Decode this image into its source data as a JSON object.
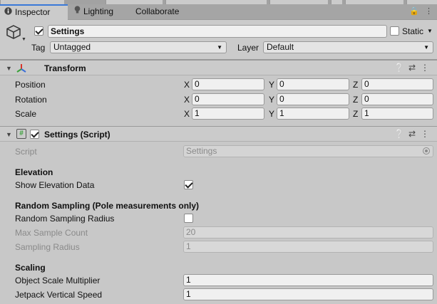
{
  "tabs": [
    {
      "label": "Inspector",
      "icon": "info-icon",
      "active": true
    },
    {
      "label": "Lighting",
      "icon": "bulb-icon",
      "active": false
    },
    {
      "label": "Collaborate",
      "active": false
    }
  ],
  "header": {
    "active_checked": true,
    "name": "Settings",
    "static_label": "Static",
    "static_checked": false,
    "tag_label": "Tag",
    "tag_value": "Untagged",
    "layer_label": "Layer",
    "layer_value": "Default"
  },
  "transform": {
    "title": "Transform",
    "rows": [
      {
        "label": "Position",
        "x": "0",
        "y": "0",
        "z": "0"
      },
      {
        "label": "Rotation",
        "x": "0",
        "y": "0",
        "z": "0"
      },
      {
        "label": "Scale",
        "x": "1",
        "y": "1",
        "z": "1"
      }
    ],
    "axes": {
      "x": "X",
      "y": "Y",
      "z": "Z"
    }
  },
  "script_component": {
    "title": "Settings (Script)",
    "enabled": true,
    "script_label": "Script",
    "script_value": "Settings",
    "sections": {
      "elevation": "Elevation",
      "random_sampling": "Random Sampling (Pole measurements only)",
      "scaling": "Scaling"
    },
    "fields": {
      "show_elevation_label": "Show Elevation Data",
      "show_elevation_checked": true,
      "random_radius_label": "Random Sampling Radius",
      "random_radius_checked": false,
      "max_sample_label": "Max Sample Count",
      "max_sample_value": "20",
      "sampling_radius_label": "Sampling Radius",
      "sampling_radius_value": "1",
      "object_scale_label": "Object Scale Multiplier",
      "object_scale_value": "1",
      "jetpack_label": "Jetpack Vertical Speed",
      "jetpack_value": "1"
    }
  },
  "colors": {
    "active_tab_accent": "#3a79d8",
    "transform_x": "#d8352a",
    "transform_y": "#3aa13a",
    "transform_z": "#3a6fd8"
  }
}
